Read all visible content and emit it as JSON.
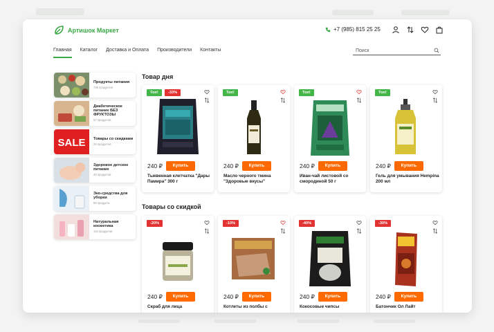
{
  "brand": {
    "name": "Артишок Маркет",
    "color": "#3aa845"
  },
  "header": {
    "phone": "+7 (985) 815 25 25"
  },
  "nav": [
    "Главная",
    "Каталог",
    "Доставка и Оплата",
    "Производители",
    "Контакты"
  ],
  "search": {
    "placeholder": "Поиск"
  },
  "categories": [
    {
      "name": "Продукты питания",
      "count": "735 продуктов"
    },
    {
      "name": "Диабетическое питание БЕЗ ФРУКТОЗЫ",
      "count": "57 продуктов"
    },
    {
      "name": "Товары со скидками",
      "count": "25 продуктов",
      "banner": "SALE"
    },
    {
      "name": "Здоровое детское питание",
      "count": "45 продуктов"
    },
    {
      "name": "Эко-средства для уборки",
      "count": "88 продукта"
    },
    {
      "name": "Натуральная косметика",
      "count": "115 продуктов"
    }
  ],
  "sections": [
    {
      "title": "Товар дня",
      "products": [
        {
          "badge": "Топ!",
          "sale": "-33%",
          "price": "240 ₽",
          "buy": "Купить",
          "name": "Тыквенная клетчатка \"Дары Памира\" 300 г"
        },
        {
          "badge": "Топ!",
          "price": "240 ₽",
          "buy": "Купить",
          "name": "Масло черного тмина \"Здоровые вкусы\""
        },
        {
          "badge": "Топ!",
          "price": "240 ₽",
          "buy": "Купить",
          "name": "Иван-чай листовой со смородиной 50 г"
        },
        {
          "badge": "Топ!",
          "price": "240 ₽",
          "buy": "Купить",
          "name": "Гель для умывания Hempina 200 мл"
        }
      ]
    },
    {
      "title": "Товары со скидкой",
      "products": [
        {
          "sale": "-20%",
          "price": "240 ₽",
          "buy": "Купить",
          "name": "Скраб для лица"
        },
        {
          "sale": "-10%",
          "price": "240 ₽",
          "buy": "Купить",
          "name": "Котлеты из полбы с"
        },
        {
          "sale": "-40%",
          "price": "240 ₽",
          "buy": "Купить",
          "name": "Кокосовые чипсы"
        },
        {
          "sale": "-30%",
          "price": "240 ₽",
          "buy": "Купить",
          "name": "Батончик Ол Лайт"
        }
      ]
    }
  ]
}
